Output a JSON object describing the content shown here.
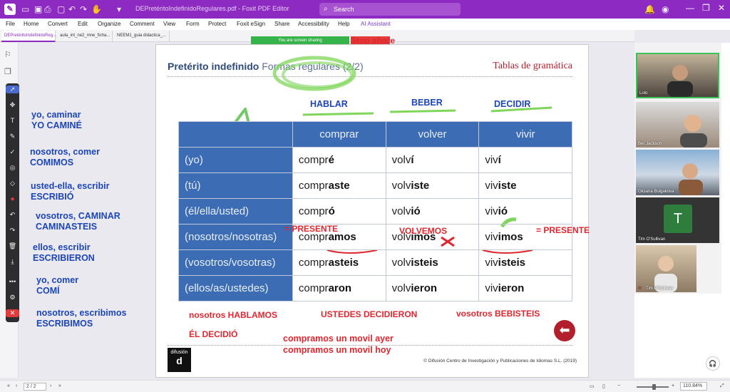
{
  "window": {
    "doc_title": "DEPretéritoIndefinidoRegulares.pdf - Foxit PDF Editor",
    "search_placeholder": "Search",
    "controls": [
      "—",
      "❐",
      "✕"
    ]
  },
  "menu": [
    "File",
    "Home",
    "Convert",
    "Edit",
    "Organize",
    "Comment",
    "View",
    "Form",
    "Protect",
    "Foxit eSign",
    "Share",
    "Accessibility",
    "Help",
    "AI Assistant"
  ],
  "tabs": [
    "DEPretéritoIndefinidoReg...",
    "aula_int_ne2_mne_ficha...",
    "NEEM1_guia didactica_..."
  ],
  "sharing": {
    "status": "You are screen sharing",
    "stop": "Stop share"
  },
  "notes": [
    {
      "line1": "yo, caminar",
      "line2": "YO CAMINÉ"
    },
    {
      "line1": "nosotros, comer",
      "line2": "COMIMOS"
    },
    {
      "line1": "usted-ella, escribir",
      "line2": "ESCRIBIÓ"
    },
    {
      "line1": "vosotros, CAMINAR",
      "line2": "CAMINASTEIS"
    },
    {
      "line1": "ellos, escribir",
      "line2": "ESCRIBIERON"
    },
    {
      "line1": "yo, comer",
      "line2": "COMÍ"
    },
    {
      "line1": "nosotros, escribimos",
      "line2": "ESCRIBIMOS"
    }
  ],
  "page": {
    "title_bold": "Pretérito indefinido",
    "title_rest": "Formas regulares (2/2)",
    "subject": "Tablas de gramática",
    "verb_heads": [
      "HABLAR",
      "BEBER",
      "DECIDIR"
    ],
    "columns": [
      "comprar",
      "volver",
      "vivir"
    ],
    "rows": [
      {
        "person": "(yo)",
        "forms": [
          [
            "compr",
            "é"
          ],
          [
            "volv",
            "í"
          ],
          [
            "viv",
            "í"
          ]
        ]
      },
      {
        "person": "(tú)",
        "forms": [
          [
            "compr",
            "aste"
          ],
          [
            "volv",
            "iste"
          ],
          [
            "viv",
            "iste"
          ]
        ]
      },
      {
        "person": "(él/ella/usted)",
        "forms": [
          [
            "compr",
            "ó"
          ],
          [
            "volv",
            "ió"
          ],
          [
            "viv",
            "ió"
          ]
        ]
      },
      {
        "person": "(nosotros/nosotras)",
        "forms": [
          [
            "compr",
            "amos"
          ],
          [
            "volv",
            "imos"
          ],
          [
            "viv",
            "imos"
          ]
        ]
      },
      {
        "person": "(vosotros/vosotras)",
        "forms": [
          [
            "compr",
            "asteis"
          ],
          [
            "volv",
            "isteis"
          ],
          [
            "viv",
            "isteis"
          ]
        ]
      },
      {
        "person": "(ellos/as/ustedes)",
        "forms": [
          [
            "compr",
            "aron"
          ],
          [
            "volv",
            "ieron"
          ],
          [
            "viv",
            "ieron"
          ]
        ]
      }
    ],
    "annotations": {
      "presente_left": "= PRESENTE",
      "volvemos": "VOLVEMOS",
      "presente_right": "= PRESENTE",
      "hablamos": "nosotros HABLAMOS",
      "decidieron": "USTEDES DECIDIERON",
      "bebisteis": "vosotros BEBISTEIS",
      "decidio": "ÉL DECIDIÓ",
      "ayer": "compramos un movil ayer",
      "hoy": "compramos un movil hoy"
    },
    "logo": "difusión",
    "copyright": "© Difusión Centro de Investigación y Publicaciones de Idiomas S.L. (2019)"
  },
  "participants": [
    {
      "name": "Lolo"
    },
    {
      "name": "Ber Jackson"
    },
    {
      "name": "Oksana Bulgakova"
    },
    {
      "name": "Tim O'Sullivan",
      "initial": "T"
    },
    {
      "name": "Tim O'Sullivan"
    }
  ],
  "status": {
    "page": "2 / 2",
    "zoom": "110.84%"
  }
}
